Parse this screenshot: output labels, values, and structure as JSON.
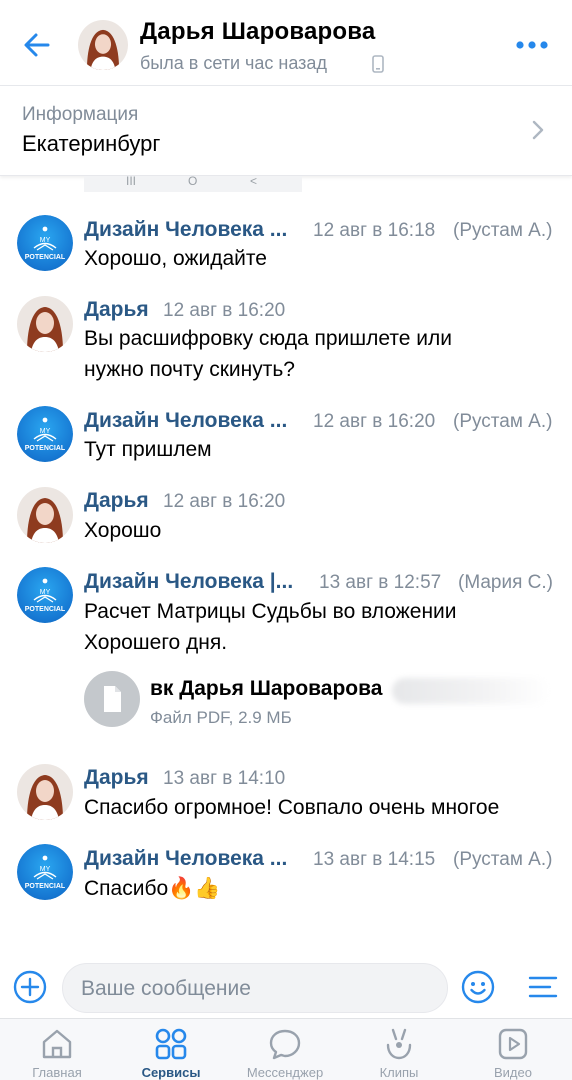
{
  "header": {
    "back_icon": "arrow-left-icon",
    "name": "Дарья Шароварова",
    "status": "была в сети час назад",
    "status_icon": "phone-icon",
    "more_icon": "more-dots-icon"
  },
  "info": {
    "label": "Информация",
    "value": "Екатеринбург"
  },
  "nav_strip": {
    "recents": "III",
    "home": "O",
    "back": "<"
  },
  "messages": [
    {
      "sender": "Дизайн Человека ...",
      "time": "12 авг в 16:18",
      "author": "(Рустам А.)",
      "lines": [
        "Хорошо, ожидайте"
      ],
      "avatar": "my-potencial-logo"
    },
    {
      "sender": "Дарья",
      "time": "12 авг в 16:20",
      "author": "",
      "lines": [
        "Вы расшифровку сюда пришлете или",
        "нужно почту скинуть?"
      ],
      "avatar": "user-photo"
    },
    {
      "sender": "Дизайн Человека ...",
      "time": "12 авг в 16:20",
      "author": "(Рустам А.)",
      "lines": [
        "Тут пришлем"
      ],
      "avatar": "my-potencial-logo"
    },
    {
      "sender": "Дарья",
      "time": "12 авг в 16:20",
      "author": "",
      "lines": [
        "Хорошо"
      ],
      "avatar": "user-photo"
    },
    {
      "sender": "Дизайн Человека |...",
      "time": "13 авг в 12:57",
      "author": "(Мария С.)",
      "lines": [
        "Расчет Матрицы Судьбы во вложении",
        "Хорошего дня."
      ],
      "avatar": "my-potencial-logo",
      "attachment": {
        "icon": "document-icon",
        "name": "вк Дарья Шароварова",
        "meta": "Файл PDF, 2.9 МБ"
      }
    },
    {
      "sender": "Дарья",
      "time": "13 авг в 14:10",
      "author": "",
      "lines": [
        "Спасибо огромное! Совпало очень многое"
      ],
      "avatar": "user-photo"
    },
    {
      "sender": "Дизайн Человека ...",
      "time": "13 авг в 14:15",
      "author": "(Рустам А.)",
      "lines": [
        "Спасибо🔥👍"
      ],
      "avatar": "my-potencial-logo"
    }
  ],
  "logo_text": {
    "line1": "MY",
    "line2": "POTENCIAL"
  },
  "composer": {
    "placeholder": "Ваше сообщение",
    "add_icon": "plus-circle-icon",
    "emoji_icon": "smile-icon",
    "menu_icon": "menu-lines-icon"
  },
  "tabs": [
    {
      "label": "Главная",
      "icon": "home-icon",
      "active": false
    },
    {
      "label": "Сервисы",
      "icon": "services-grid-icon",
      "active": true
    },
    {
      "label": "Мессенджер",
      "icon": "chat-bubble-icon",
      "active": false
    },
    {
      "label": "Клипы",
      "icon": "clips-icon",
      "active": false
    },
    {
      "label": "Видео",
      "icon": "video-icon",
      "active": false
    }
  ],
  "colors": {
    "accent": "#2688eb",
    "link": "#2a5885",
    "secondary_text": "#818c99",
    "logo_blue": "#1677d2"
  }
}
